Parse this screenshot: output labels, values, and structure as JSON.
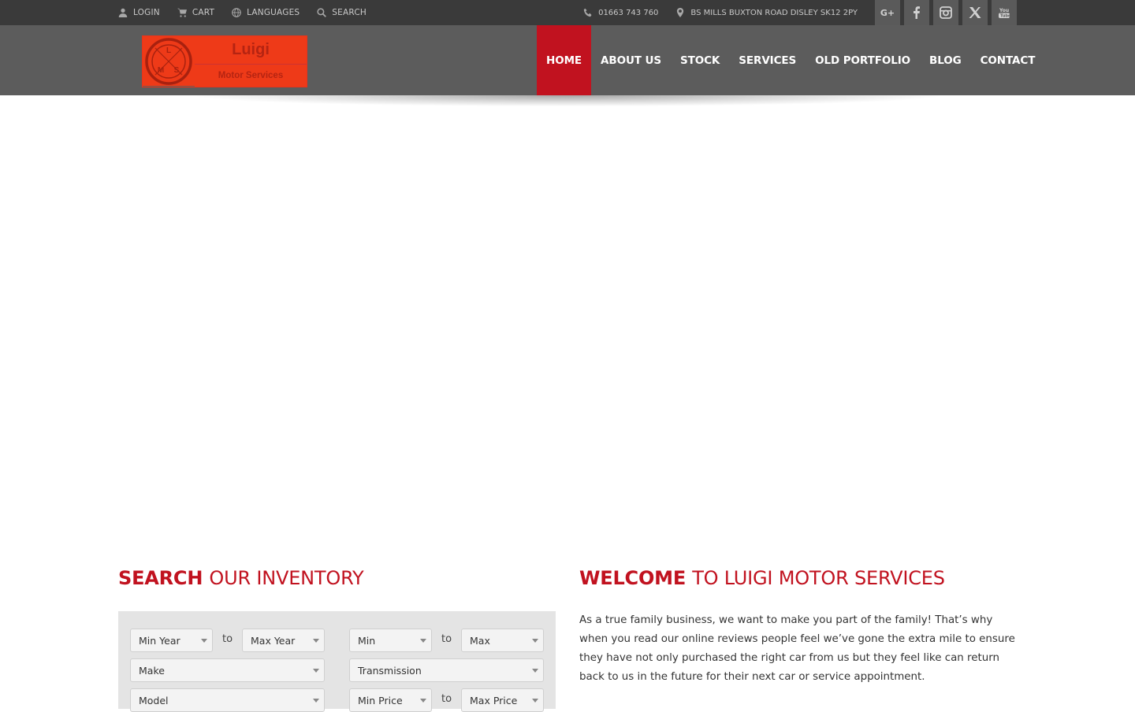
{
  "topbar": {
    "login": "LOGIN",
    "cart": "CART",
    "languages": "LANGUAGES",
    "search": "SEARCH",
    "phone": "01663 743 760",
    "address": "BS MILLS BUXTON ROAD DISLEY SK12 2PY",
    "socials": [
      "G+",
      "facebook-icon",
      "instagram-icon",
      "x-icon",
      "youtube-icon"
    ]
  },
  "logo": {
    "name": "Luigi",
    "sub": "Motor Services",
    "emblem_letters": [
      "L",
      "M",
      "S"
    ]
  },
  "nav": {
    "items": [
      {
        "label": "HOME",
        "active": true
      },
      {
        "label": "ABOUT US",
        "active": false
      },
      {
        "label": "STOCK",
        "active": false
      },
      {
        "label": "SERVICES",
        "active": false
      },
      {
        "label": "OLD PORTFOLIO",
        "active": false
      },
      {
        "label": "BLOG",
        "active": false
      },
      {
        "label": "CONTACT",
        "active": false
      }
    ]
  },
  "search_section": {
    "title_bold": "SEARCH",
    "title_light": "OUR INVENTORY",
    "fields": {
      "min_year": "Min Year",
      "max_year": "Max Year",
      "min_mileage": "Min",
      "max_mileage": "Max",
      "make": "Make",
      "transmission": "Transmission",
      "model": "Model",
      "min_price": "Min Price",
      "max_price": "Max Price"
    },
    "to": "to"
  },
  "welcome_section": {
    "title_bold": "WELCOME",
    "title_light": "TO LUIGI MOTOR SERVICES",
    "body": "As a true family business, we want to make you part of the family!   That’s why when you read our online reviews people feel we’ve gone the extra mile to ensure they have not only purchased the right car from us but they feel like can return back to us in the future for their next car or service appointment."
  },
  "colors": {
    "accent": "#c1121f",
    "topbar": "#3a3a3a",
    "header": "#5c5c5c",
    "logo_red": "#ee3a18"
  }
}
